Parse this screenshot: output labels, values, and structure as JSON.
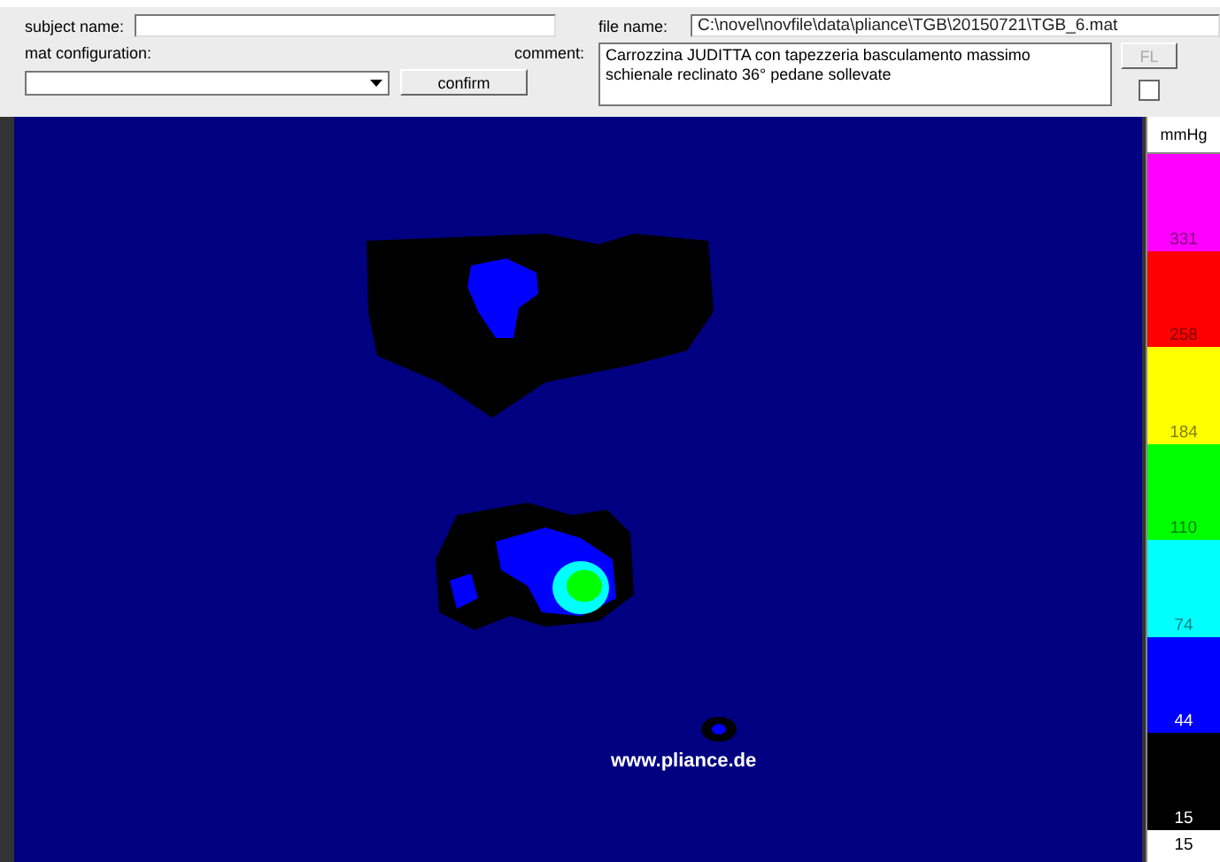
{
  "form": {
    "subject_name": {
      "label": "subject name:"
    },
    "file_name": {
      "label": "file name:",
      "value": "C:\\novel\\novfile\\data\\pliance\\TGB\\20150721\\TGB_6.mat"
    },
    "mat_configuration": {
      "label": "mat configuration:"
    },
    "comment": {
      "label": "comment:",
      "value": "Carrozzina JUDITTA con tapezzeria basculamento massimo\nschienale reclinato 36° pedane sollevate"
    },
    "confirm_button": "confirm",
    "fl_button": {
      "label": "FL",
      "disabled": true
    },
    "checkbox": {
      "checked": false
    }
  },
  "map": {
    "watermark_text": "www.pliance.de"
  },
  "legend": {
    "unit": "mmHg",
    "bands": [
      {
        "label": "331",
        "color": "#ff00ff"
      },
      {
        "label": "258",
        "color": "#ff0000"
      },
      {
        "label": "184",
        "color": "#ffff00"
      },
      {
        "label": "110",
        "color": "#00ff00"
      },
      {
        "label": "74",
        "color": "#00ffff"
      },
      {
        "label": "44",
        "color": "#0000ff"
      },
      {
        "label": "15",
        "color": "#000000"
      }
    ],
    "minimum": "15"
  }
}
